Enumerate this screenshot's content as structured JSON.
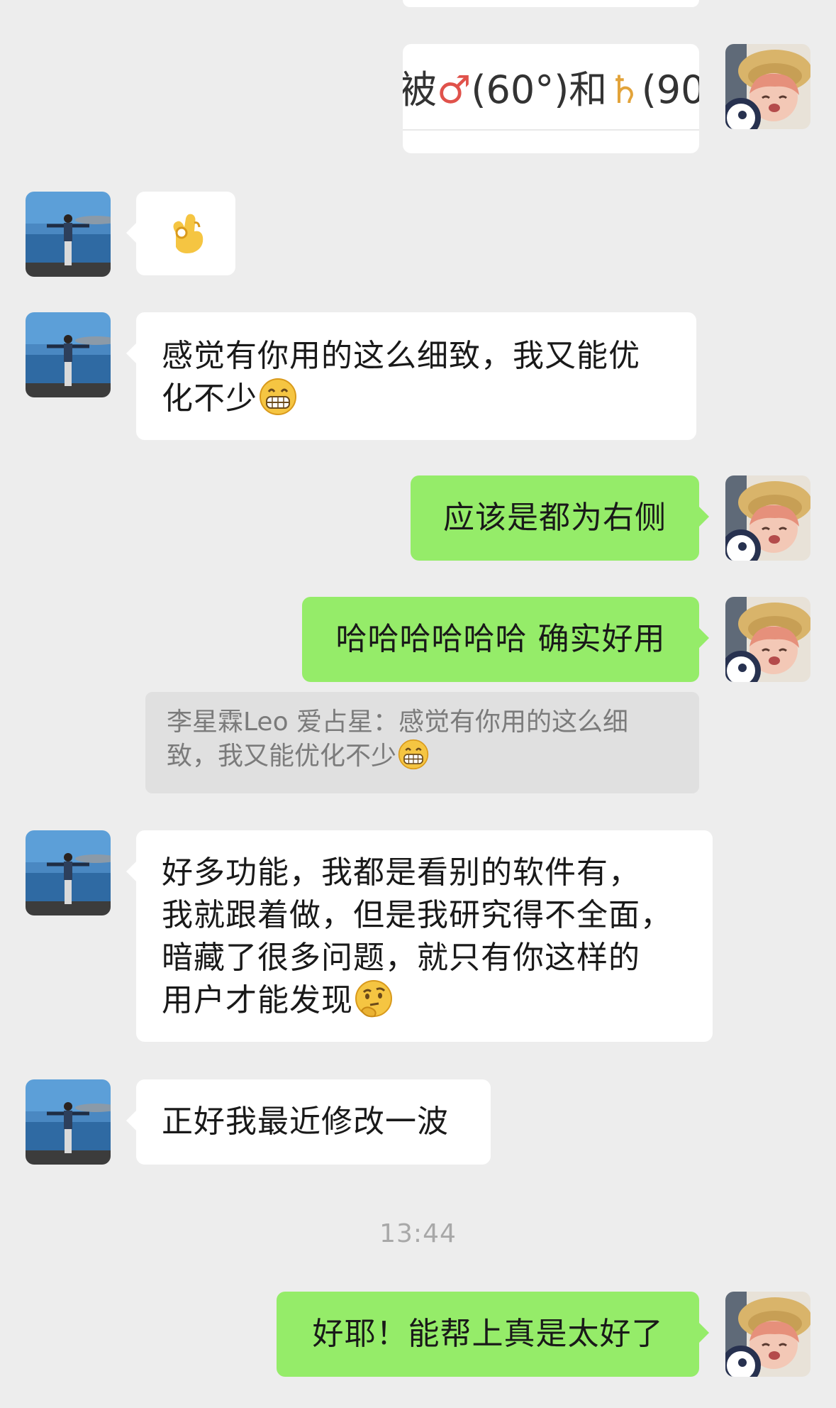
{
  "conversation": {
    "top_card": {
      "text_prefix": "被",
      "mars_symbol": "♂",
      "text_mid": "(60°)和",
      "saturn_symbol": "♄",
      "text_suffix": "(90"
    },
    "messages": [
      {
        "side": "left",
        "text": "👌"
      },
      {
        "side": "left",
        "line1": "感觉有你用的这么细致，我又能优",
        "line2": "化不少"
      },
      {
        "side": "right",
        "text": "应该是都为右侧"
      },
      {
        "side": "right",
        "text": "哈哈哈哈哈哈 确实好用"
      },
      {
        "type": "quote",
        "line1": "李星霖Leo 爱占星：感觉有你用的这么细",
        "line2": "致，我又能优化不少"
      },
      {
        "side": "left",
        "line1": "好多功能，我都是看别的软件有，",
        "line2": "我就跟着做，但是我研究得不全面，",
        "line3": "暗藏了很多问题，就只有你这样的",
        "line4": "用户才能发现"
      },
      {
        "side": "left",
        "text": "正好我最近修改一波"
      },
      {
        "type": "time",
        "text": "13:44"
      },
      {
        "side": "right",
        "text": "好耶！能帮上真是太好了"
      }
    ]
  },
  "colors": {
    "background": "#ededed",
    "incoming_bubble": "#ffffff",
    "outgoing_bubble": "#95ec69",
    "quote_bg": "#e0e0e0",
    "time_text": "#a8a8a8"
  },
  "icons": {
    "ok-hand": "ok-hand-emoji-icon",
    "grin": "grinning-face-emoji-icon",
    "thinking": "thinking-face-emoji-icon"
  }
}
